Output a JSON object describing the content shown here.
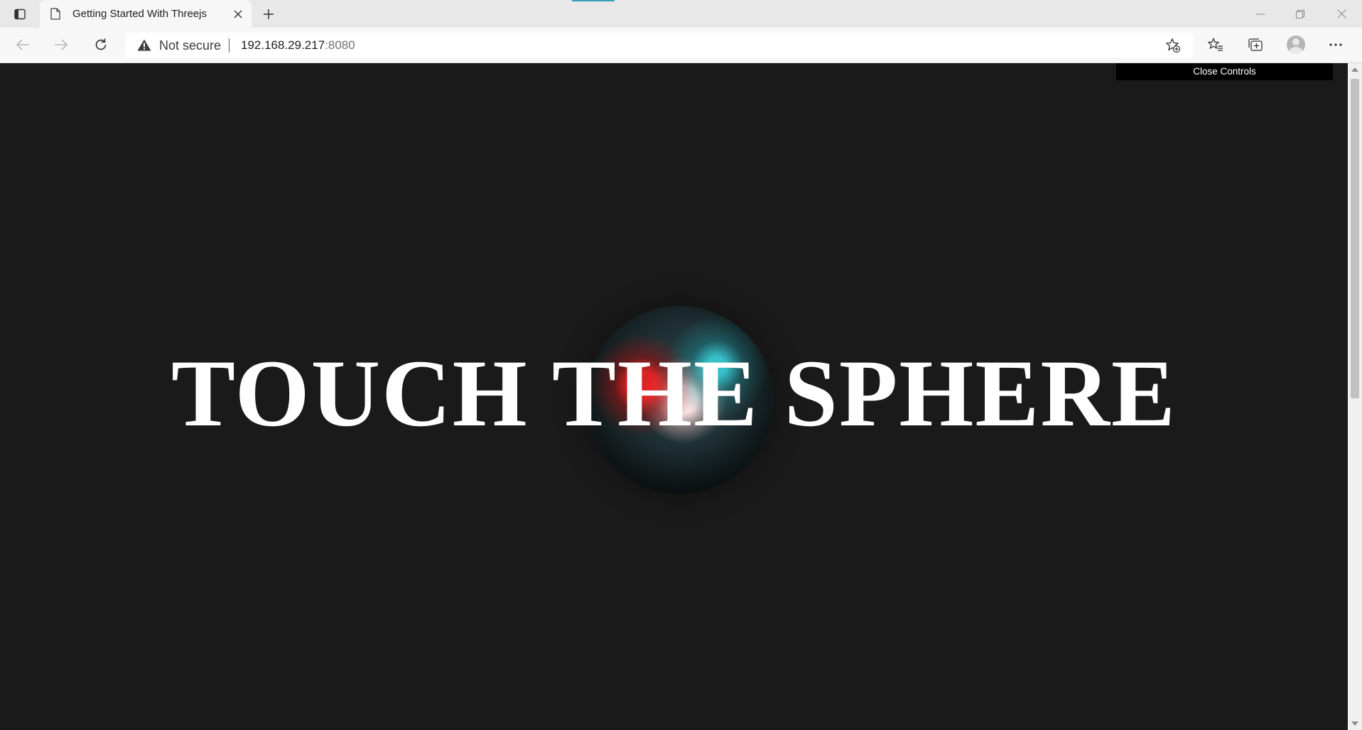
{
  "browser": {
    "tab_title": "Getting Started With Threejs",
    "security_label": "Not secure",
    "url_host": "192.168.29.217",
    "url_port": ":8080",
    "icons": {
      "tab_actions": "tab-actions-icon",
      "tab_page": "page-icon",
      "tab_close": "close-icon",
      "new_tab": "plus-icon",
      "back": "back-arrow-icon",
      "forward": "forward-arrow-icon",
      "refresh": "refresh-icon",
      "warning": "warning-icon",
      "add_favorite": "star-plus-icon",
      "favorites": "favorites-icon",
      "collections": "collections-icon",
      "profile": "profile-avatar-icon",
      "more": "more-icon",
      "minimize": "minimize-icon",
      "restore": "restore-icon",
      "close_window": "close-window-icon"
    }
  },
  "page": {
    "controls_label": "Close Controls",
    "headline": "TOUCH THE SPHERE",
    "background_color": "#1a1a1a",
    "sphere_colors": [
      "#ff1e1e",
      "#3cdce6",
      "#2e4a4f"
    ]
  }
}
